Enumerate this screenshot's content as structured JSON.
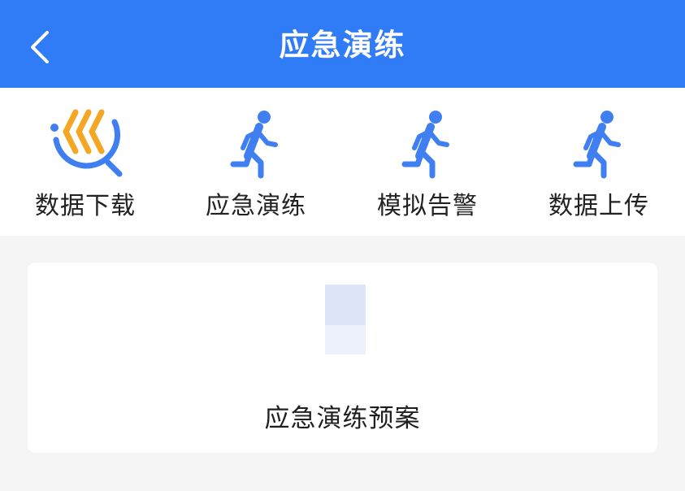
{
  "header": {
    "title": "应急演练",
    "back_icon": "chevron-left-icon"
  },
  "toolbar": {
    "items": [
      {
        "label": "数据下载",
        "icon": "data-download-icon"
      },
      {
        "label": "应急演练",
        "icon": "running-person-icon"
      },
      {
        "label": "模拟告警",
        "icon": "running-person-icon"
      },
      {
        "label": "数据上传",
        "icon": "running-person-icon"
      }
    ]
  },
  "card": {
    "label": "应急演练预案",
    "image": "placeholder-image"
  },
  "colors": {
    "header_bg": "#2f7cf6",
    "icon_blue": "#3f7ff2",
    "icon_orange": "#f5a623",
    "page_bg": "#f5f5f5",
    "card_bg": "#ffffff"
  }
}
